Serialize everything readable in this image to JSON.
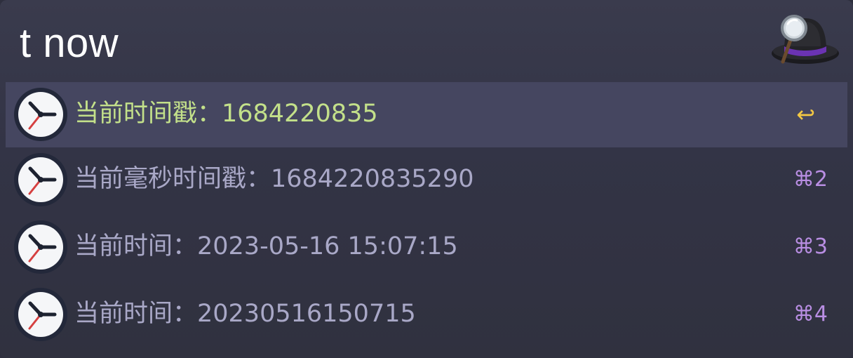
{
  "search": {
    "query": "t now"
  },
  "results": [
    {
      "title": "当前时间戳：1684220835",
      "shortcut": "↩",
      "icon": "clock-icon",
      "selected": true
    },
    {
      "title": "当前毫秒时间戳：1684220835290",
      "shortcut": "⌘2",
      "icon": "clock-icon",
      "selected": false
    },
    {
      "title": "当前时间：2023-05-16 15:07:15",
      "shortcut": "⌘3",
      "icon": "clock-icon",
      "selected": false
    },
    {
      "title": "当前时间：20230516150715",
      "shortcut": "⌘4",
      "icon": "clock-icon",
      "selected": false
    }
  ],
  "colors": {
    "selected_title": "#c3e08a",
    "title": "#a9a8c7",
    "shortcut": "#b98ee3",
    "return_key": "#f2c744",
    "selected_row": "#454660"
  }
}
